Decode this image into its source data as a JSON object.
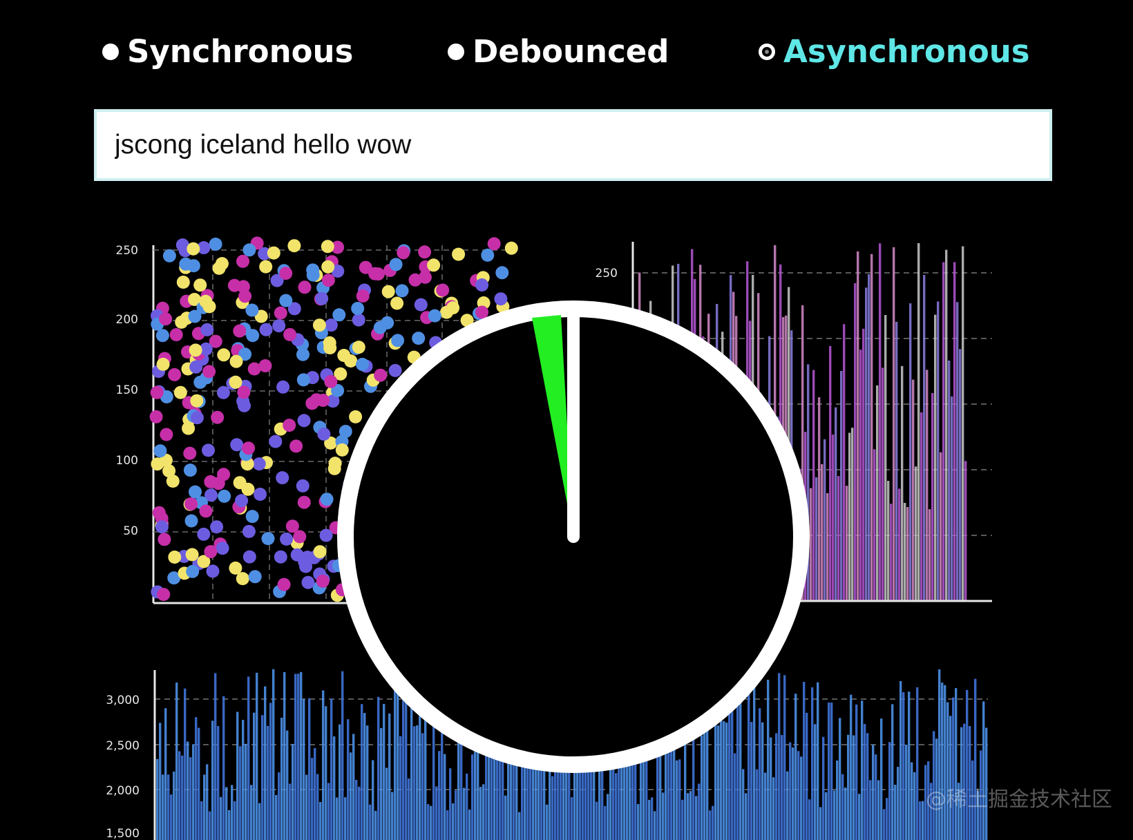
{
  "modes": [
    {
      "label": "Synchronous",
      "selected": false
    },
    {
      "label": "Debounced",
      "selected": false
    },
    {
      "label": "Asynchronous",
      "selected": true
    }
  ],
  "accent_color": "#5fe6e6",
  "search": {
    "value": "jscong iceland hello wow"
  },
  "scatter_ticks": [
    "250",
    "200",
    "150",
    "100",
    "50"
  ],
  "bar_ticks": [
    "250"
  ],
  "bottom_ticks": [
    "3,000",
    "2,500",
    "2,000",
    "1,500"
  ],
  "spinner": {
    "colors": {
      "ring": "#ffffff",
      "wedge": "#22ee22",
      "center": "#000000"
    }
  },
  "watermark": "@稀土掘金技术社区",
  "chart_data": [
    {
      "type": "scatter",
      "ylim": [
        0,
        250
      ],
      "yticks": [
        50,
        100,
        150,
        200,
        250
      ],
      "colors": [
        "#f2e36b",
        "#c62fa8",
        "#6c5de0",
        "#4f8fe3"
      ]
    },
    {
      "type": "bar",
      "yticks": [
        250
      ],
      "colors": [
        "#b657d6",
        "#8a7ee0",
        "#d58ac8",
        "#c9c9c9"
      ]
    },
    {
      "type": "bar",
      "yticks": [
        1500,
        2000,
        2500,
        3000
      ],
      "colors": [
        "#3f73d8",
        "#4b8fe6"
      ]
    }
  ]
}
